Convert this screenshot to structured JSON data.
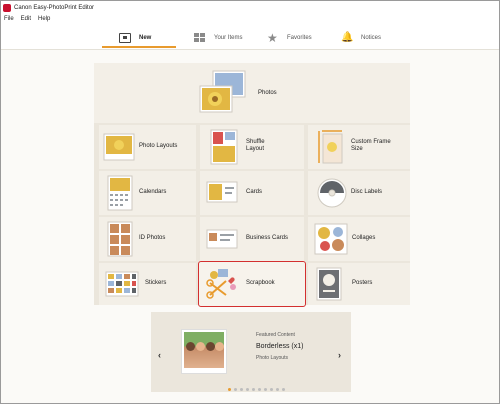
{
  "window": {
    "title": "Canon Easy-PhotoPrint Editor"
  },
  "menu": [
    "File",
    "Edit",
    "Help"
  ],
  "tabs": [
    {
      "label": "New",
      "icon": "new-icon",
      "active": true
    },
    {
      "label": "Your Items",
      "icon": "grid-icon",
      "active": false
    },
    {
      "label": "Favorites",
      "icon": "star-icon",
      "active": false
    },
    {
      "label": "Notices",
      "icon": "bell-icon",
      "active": false
    }
  ],
  "tiles": {
    "photos": "Photos",
    "photo_layouts": "Photo Layouts",
    "shuffle_layout_line1": "Shuffle",
    "shuffle_layout_line2": "Layout",
    "custom_frame_line1": "Custom Frame",
    "custom_frame_line2": "Size",
    "calendars": "Calendars",
    "cards": "Cards",
    "disc_labels": "Disc Labels",
    "id_photos": "ID Photos",
    "business_cards": "Business Cards",
    "collages": "Collages",
    "stickers": "Stickers",
    "scrapbook": "Scrapbook",
    "posters": "Posters"
  },
  "featured": {
    "heading": "Featured Content",
    "title": "Borderless (x1)",
    "category": "Photo Layouts",
    "prev_symbol": "‹",
    "next_symbol": "›",
    "page_count": 10,
    "active_page": 1
  },
  "colors": {
    "accent": "#e89b2e",
    "selection": "#d32f2f"
  }
}
